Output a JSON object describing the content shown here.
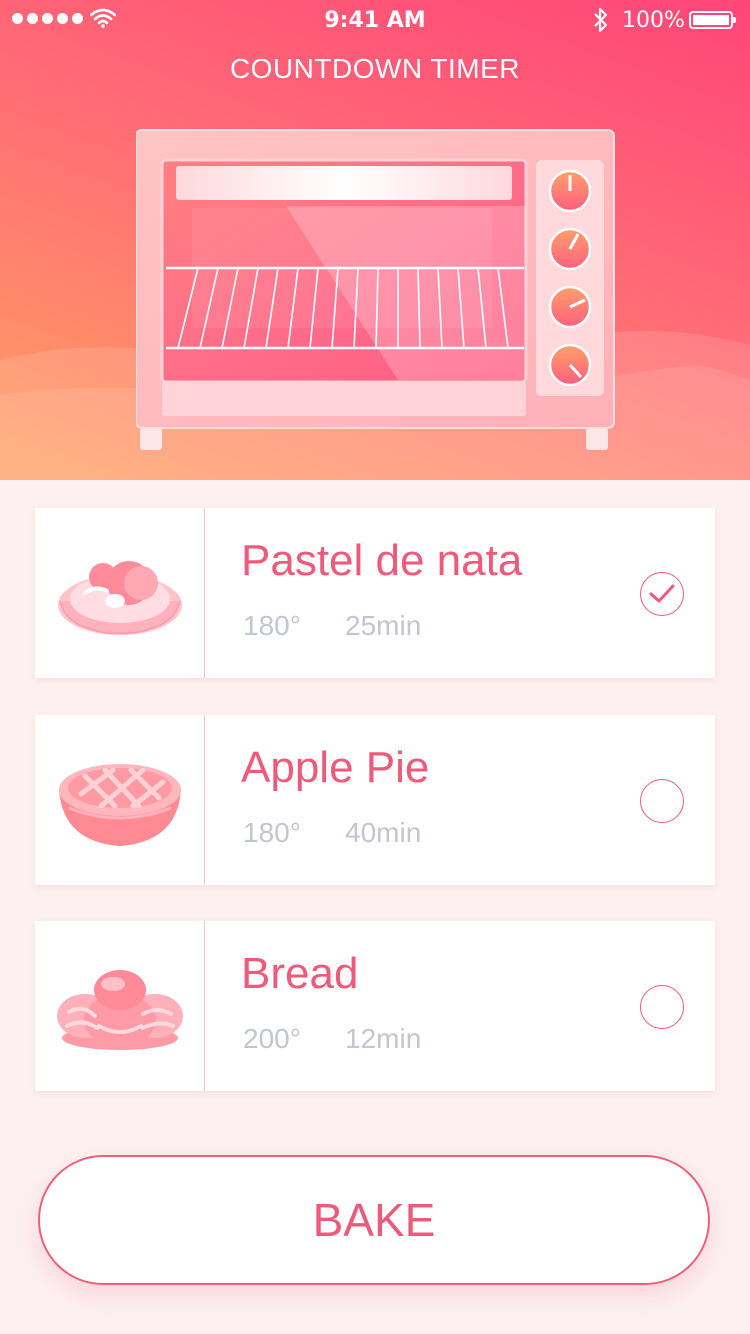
{
  "status_bar": {
    "time": "9:41 AM",
    "battery": "100%",
    "signal_icon": "signal-dots-icon",
    "wifi_icon": "wifi-icon",
    "bluetooth_icon": "bluetooth-icon",
    "battery_icon": "battery-icon"
  },
  "header": {
    "title": "COUNTDOWN TIMER"
  },
  "colors": {
    "accent": "#ef5a7a",
    "gradient_start": "#ffa062",
    "gradient_end": "#ff4579",
    "muted_text": "#c3c6d0"
  },
  "recipes": [
    {
      "name": "Pastel de nata",
      "temperature": "180°",
      "duration": "25min",
      "selected": true,
      "icon": "pastel-de-nata-icon"
    },
    {
      "name": "Apple Pie",
      "temperature": "180°",
      "duration": "40min",
      "selected": false,
      "icon": "apple-pie-icon"
    },
    {
      "name": "Bread",
      "temperature": "200°",
      "duration": "12min",
      "selected": false,
      "icon": "bread-icon"
    }
  ],
  "action": {
    "bake_label": "BAKE"
  }
}
